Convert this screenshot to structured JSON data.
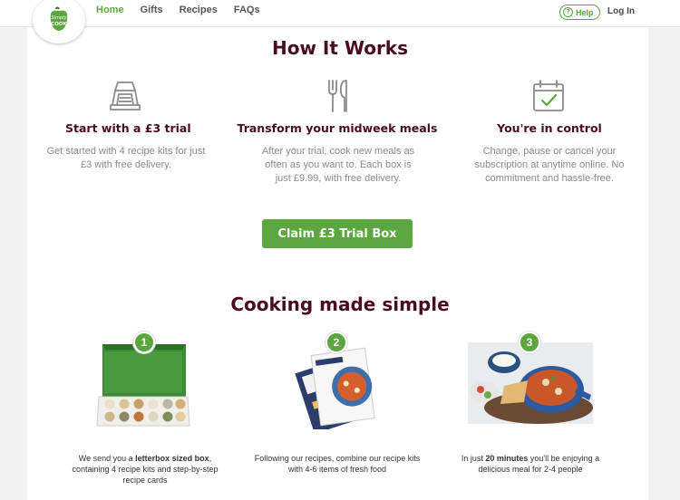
{
  "nav": {
    "logo_text_top": "Simply",
    "logo_text_bottom": "COOK",
    "items": [
      {
        "label": "Home"
      },
      {
        "label": "Gifts"
      },
      {
        "label": "Recipes"
      },
      {
        "label": "FAQs"
      }
    ],
    "help_label": "Help",
    "login_label": "Log In"
  },
  "how_it_works": {
    "title": "How It Works",
    "steps": [
      {
        "icon": "letterbox-icon",
        "heading": "Start with a £3 trial",
        "text": "Get started with 4 recipe kits for just £3 with free delivery."
      },
      {
        "icon": "cutlery-icon",
        "heading": "Transform your midweek meals",
        "text": "After your trial, cook new meals as often as you want to. Each box is just £9.99, with free delivery."
      },
      {
        "icon": "calendar-check-icon",
        "heading": "You're in control",
        "text": "Change, pause or cancel your subscription at anytime online. No commitment and hassle-free."
      }
    ],
    "cta_label": "Claim £3 Trial Box"
  },
  "cooking": {
    "title": "Cooking made simple",
    "items": [
      {
        "number": "1",
        "caption_parts": [
          "We send you a ",
          "letterbox sized box",
          ", containing 4 recipe kits and step-by-step recipe cards"
        ]
      },
      {
        "number": "2",
        "caption_parts": [
          "Following our recipes, combine our recipe kits with 4-6 items of fresh food",
          "",
          ""
        ]
      },
      {
        "number": "3",
        "caption_parts": [
          "In just ",
          "20 minutes",
          " you'll be enjoying a delicious meal for 2-4 people"
        ]
      }
    ]
  },
  "colors": {
    "brand_green": "#5ba63e",
    "heading_maroon": "#4a0d1f"
  }
}
